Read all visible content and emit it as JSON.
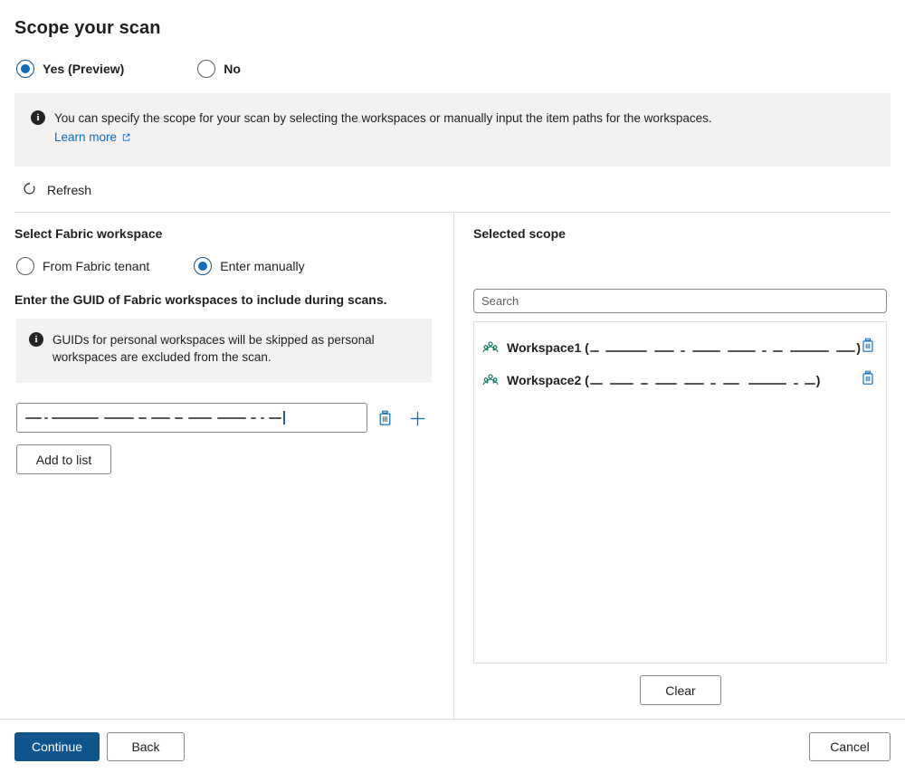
{
  "page": {
    "title": "Scope your scan"
  },
  "scope_choice": {
    "options": [
      {
        "label": "Yes (Preview)",
        "checked": true
      },
      {
        "label": "No",
        "checked": false
      }
    ]
  },
  "info_banner": {
    "icon": "info-icon",
    "text": "You can specify the scope for your scan by selecting the workspaces or manually input the item paths for the workspaces.",
    "link_label": "Learn more",
    "link_icon": "external-link-icon"
  },
  "toolbar": {
    "refresh_label": "Refresh",
    "refresh_icon": "refresh-icon"
  },
  "left_panel": {
    "section_label": "Select Fabric workspace",
    "source_options": [
      {
        "label": "From Fabric tenant",
        "checked": false
      },
      {
        "label": "Enter manually",
        "checked": true
      }
    ],
    "guid_instruction": "Enter the GUID of Fabric workspaces to include during scans.",
    "personal_note": {
      "icon": "info-icon",
      "text": "GUIDs for personal workspaces will be skipped as personal workspaces are excluded from the scan."
    },
    "guid_input": {
      "value": "",
      "placeholder": "",
      "redacted": true
    },
    "row_delete_icon": "delete-icon",
    "row_add_icon": "add-icon",
    "add_to_list_label": "Add to list"
  },
  "right_panel": {
    "heading": "Selected scope",
    "search": {
      "placeholder": "Search",
      "value": ""
    },
    "items": [
      {
        "icon": "workspace-group-icon",
        "name": "Workspace1",
        "guid": "",
        "guid_redacted": true,
        "delete_icon": "delete-icon"
      },
      {
        "icon": "workspace-group-icon",
        "name": "Workspace2",
        "guid": "",
        "guid_redacted": true,
        "delete_icon": "delete-icon"
      }
    ],
    "clear_label": "Clear"
  },
  "footer": {
    "continue_label": "Continue",
    "back_label": "Back",
    "cancel_label": "Cancel"
  },
  "colors": {
    "accent_blue": "#0f6cbd",
    "primary_button": "#0f548c",
    "link_blue": "#0f6cbd",
    "workspace_icon_teal": "#0e7c66",
    "banner_bg": "#f3f2f1",
    "border_gray": "#8a8886",
    "divider_gray": "#e1dfdd",
    "text_primary": "#201f1e"
  }
}
